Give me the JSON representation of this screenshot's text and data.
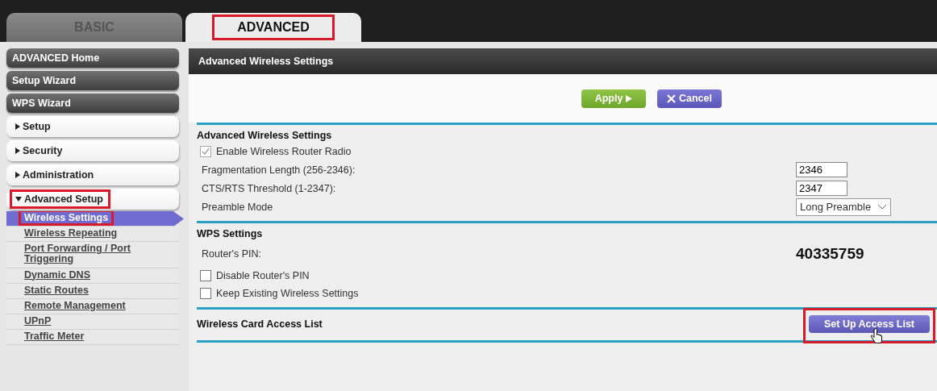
{
  "tabs": [
    {
      "label": "BASIC",
      "selected": false,
      "highlighted": false
    },
    {
      "label": "ADVANCED",
      "selected": true,
      "highlighted": true
    }
  ],
  "sidebar": {
    "items": [
      {
        "label": "ADVANCED Home",
        "kind": "dark"
      },
      {
        "label": "Setup Wizard",
        "kind": "dark"
      },
      {
        "label": "WPS Wizard",
        "kind": "dark"
      },
      {
        "label": "Setup",
        "kind": "section",
        "expanded": false,
        "highlighted": false
      },
      {
        "label": "Security",
        "kind": "section",
        "expanded": false,
        "highlighted": false
      },
      {
        "label": "Administration",
        "kind": "section",
        "expanded": false,
        "highlighted": false
      },
      {
        "label": "Advanced Setup",
        "kind": "section",
        "expanded": true,
        "highlighted": true,
        "children": [
          {
            "label": "Wireless Settings",
            "selected": true,
            "highlighted": true
          },
          {
            "label": "Wireless Repeating",
            "selected": false,
            "highlighted": false
          },
          {
            "label": "Port Forwarding / Port Triggering",
            "selected": false,
            "highlighted": false
          },
          {
            "label": "Dynamic DNS",
            "selected": false,
            "highlighted": false
          },
          {
            "label": "Static Routes",
            "selected": false,
            "highlighted": false
          },
          {
            "label": "Remote Management",
            "selected": false,
            "highlighted": false
          },
          {
            "label": "UPnP",
            "selected": false,
            "highlighted": false
          },
          {
            "label": "Traffic Meter",
            "selected": false,
            "highlighted": false
          }
        ]
      }
    ]
  },
  "panel": {
    "title": "Advanced Wireless Settings",
    "buttons": [
      {
        "label": "Apply",
        "kind": "apply"
      },
      {
        "label": "Cancel",
        "kind": "cancel"
      }
    ],
    "sections": [
      {
        "title": "Advanced Wireless Settings",
        "rows": [
          {
            "kind": "checkbox",
            "label": "Enable Wireless Router Radio",
            "checked": true,
            "disabled": true
          },
          {
            "kind": "text",
            "label": "Fragmentation Length (256-2346):",
            "value": "2346"
          },
          {
            "kind": "text",
            "label": "CTS/RTS Threshold (1-2347):",
            "value": "2347"
          },
          {
            "kind": "select",
            "label": "Preamble Mode",
            "value": "Long Preamble"
          }
        ]
      },
      {
        "title": "WPS Settings",
        "rows": [
          {
            "kind": "value",
            "label": "Router's PIN:",
            "value": "40335759"
          },
          {
            "kind": "checkbox",
            "label": "Disable Router's PIN",
            "checked": false,
            "disabled": false
          },
          {
            "kind": "checkbox",
            "label": "Keep Existing Wireless Settings",
            "checked": false,
            "disabled": false
          }
        ]
      },
      {
        "title": "Wireless Card Access List",
        "button": {
          "label": "Set Up Access List",
          "highlighted": true
        }
      }
    ]
  }
}
